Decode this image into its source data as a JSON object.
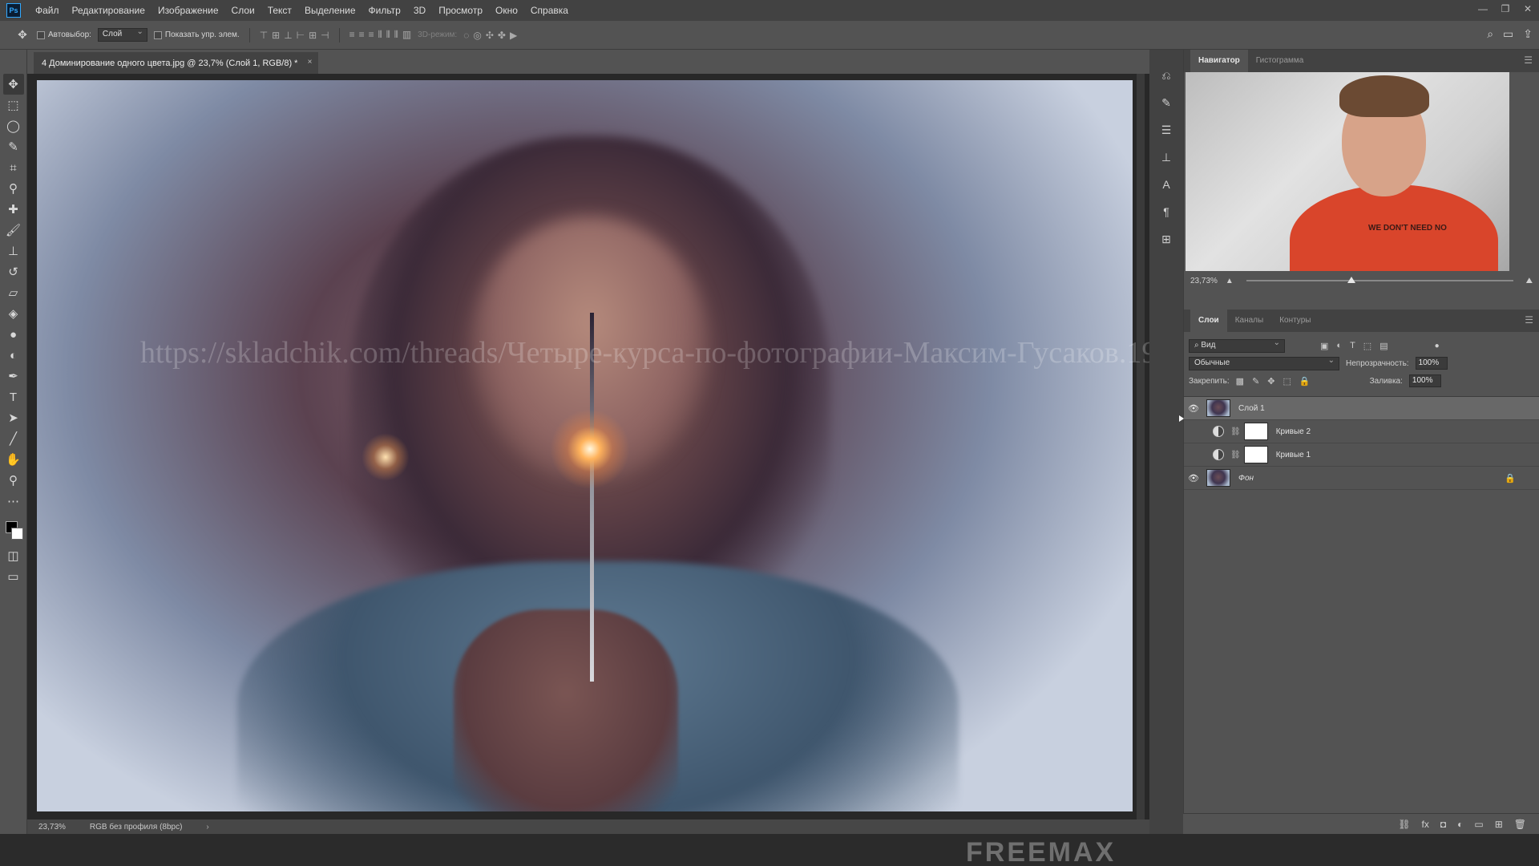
{
  "menubar": {
    "logo": "Ps",
    "items": [
      "Файл",
      "Редактирование",
      "Изображение",
      "Слои",
      "Текст",
      "Выделение",
      "Фильтр",
      "3D",
      "Просмотр",
      "Окно",
      "Справка"
    ],
    "window_controls": [
      "—",
      "❐",
      "✕"
    ]
  },
  "options": {
    "autoselect_label": "Автовыбор:",
    "autoselect_value": "Слой",
    "show_transform_label": "Показать упр. элем.",
    "mode3d_label": "3D-режим:"
  },
  "document": {
    "tab_title": "4 Доминирование одного цвета.jpg @ 23,7% (Слой 1, RGB/8) *",
    "close": "×",
    "watermark": "https://skladchik.com/threads/Четыре-курса-по-фотографии-Максим-Гусаков.192850/"
  },
  "status": {
    "zoom": "23,73%",
    "profile": "RGB без профиля (8bpc)",
    "arrow": "›"
  },
  "brand": "FREEMAX",
  "navigator": {
    "tabs": [
      "Навигатор",
      "Гистограмма"
    ],
    "active_tab": 0,
    "zoom": "23,73%",
    "zoom_fraction": 0.38,
    "shirt_print": "WE DON'T\nNEED NO"
  },
  "layers_panel": {
    "tabs": [
      "Слои",
      "Каналы",
      "Контуры"
    ],
    "active_tab": 0,
    "kind_filter": "Вид",
    "blend_mode": "Обычные",
    "opacity_label": "Непрозрачность:",
    "opacity_value": "100%",
    "lock_label": "Закрепить:",
    "fill_label": "Заливка:",
    "fill_value": "100%",
    "layers": [
      {
        "name": "Слой 1",
        "visible": true,
        "selected": true,
        "type": "pixel"
      },
      {
        "name": "Кривые 2",
        "visible": false,
        "selected": false,
        "type": "adjustment"
      },
      {
        "name": "Кривые 1",
        "visible": false,
        "selected": false,
        "type": "adjustment"
      },
      {
        "name": "Фон",
        "visible": true,
        "selected": false,
        "type": "background",
        "locked": true
      }
    ]
  }
}
